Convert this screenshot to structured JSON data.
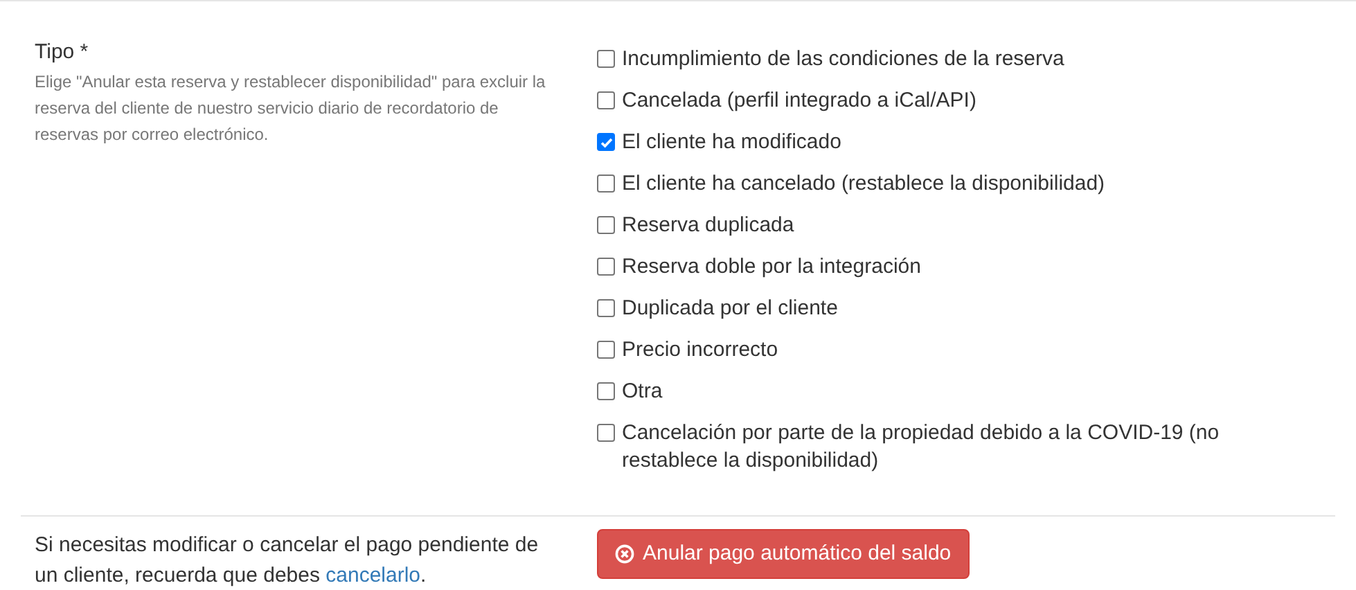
{
  "field": {
    "label": "Tipo *",
    "help": "Elige \"Anular esta reserva y restablecer disponibilidad\" para excluir la reserva del cliente de nuestro servicio diario de recordatorio de reservas por correo electrónico."
  },
  "options": [
    {
      "label": "Incumplimiento de las condiciones de la reserva",
      "checked": false
    },
    {
      "label": "Cancelada (perfil integrado a iCal/API)",
      "checked": false
    },
    {
      "label": "El cliente ha modificado",
      "checked": true
    },
    {
      "label": "El cliente ha cancelado (restablece la disponibilidad)",
      "checked": false
    },
    {
      "label": "Reserva duplicada",
      "checked": false
    },
    {
      "label": "Reserva doble por la integración",
      "checked": false
    },
    {
      "label": "Duplicada por el cliente",
      "checked": false
    },
    {
      "label": "Precio incorrecto",
      "checked": false
    },
    {
      "label": "Otra",
      "checked": false
    },
    {
      "label": "Cancelación por parte de la propiedad debido a la COVID-19 (no restablece la disponibilidad)",
      "checked": false
    }
  ],
  "payment_note": {
    "text_before": "Si necesitas modificar o cancelar el pago pendiente de un cliente, recuerda que debes ",
    "link": "cancelarlo",
    "text_after": "."
  },
  "cancel_button": {
    "label": "Anular pago automático del saldo"
  }
}
